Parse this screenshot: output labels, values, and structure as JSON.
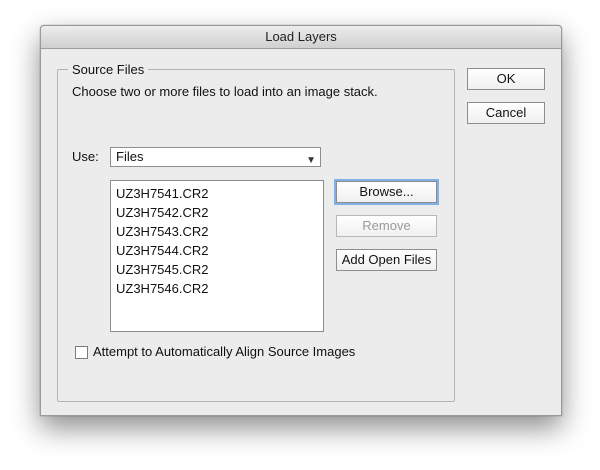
{
  "window": {
    "title": "Load Layers"
  },
  "source_files": {
    "legend": "Source Files",
    "description": "Choose two or more files to load into an image stack.",
    "use_label": "Use:",
    "use_selected": "Files",
    "files": [
      "UZ3H7541.CR2",
      "UZ3H7542.CR2",
      "UZ3H7543.CR2",
      "UZ3H7544.CR2",
      "UZ3H7545.CR2",
      "UZ3H7546.CR2"
    ],
    "browse_label": "Browse...",
    "remove_label": "Remove",
    "add_open_label": "Add Open Files",
    "align_checkbox_label": "Attempt to Automatically Align Source Images",
    "align_checked": false
  },
  "buttons": {
    "ok_label": "OK",
    "cancel_label": "Cancel"
  },
  "icons": {
    "dropdown": "chevron-down-icon"
  }
}
